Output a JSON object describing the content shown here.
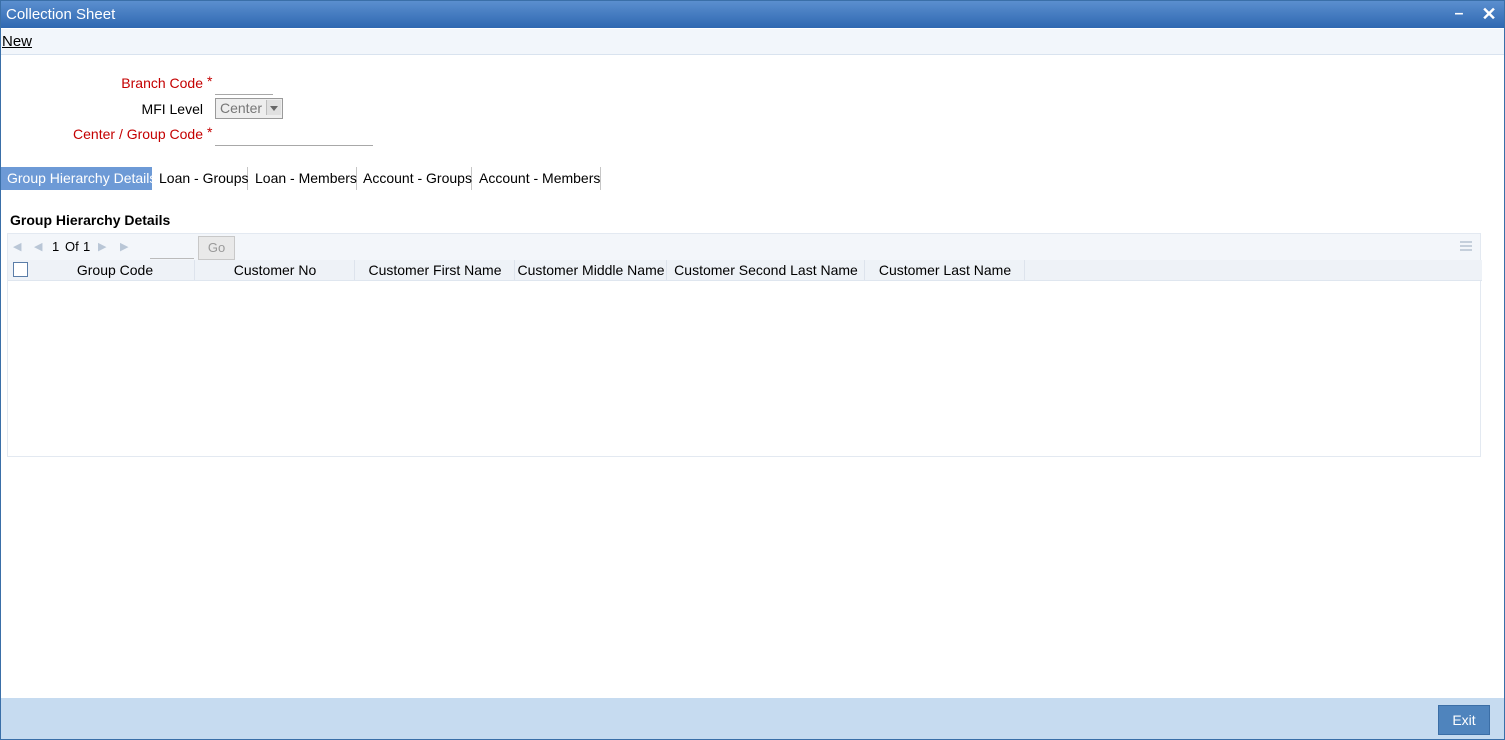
{
  "window": {
    "title": "Collection Sheet"
  },
  "menu": {
    "new_label": "New"
  },
  "form": {
    "branch_code_label": "Branch Code",
    "branch_code_value": "",
    "mfi_level_label": "MFI Level",
    "mfi_level_value": "Center",
    "center_group_label": "Center / Group Code",
    "center_group_value": "",
    "required_mark": "*"
  },
  "tabs": [
    {
      "label": "Group Hierarchy Details",
      "active": true
    },
    {
      "label": "Loan - Groups"
    },
    {
      "label": "Loan - Members"
    },
    {
      "label": "Account - Groups"
    },
    {
      "label": "Account - Members"
    }
  ],
  "section": {
    "title": "Group Hierarchy Details"
  },
  "pager": {
    "current": "1",
    "of_label": "Of",
    "total": "1",
    "go_label": "Go"
  },
  "table": {
    "columns": [
      "Group Code",
      "Customer No",
      "Customer First Name",
      "Customer Middle Name",
      "Customer Second Last Name",
      "Customer Last Name"
    ],
    "rows": []
  },
  "footer": {
    "exit_label": "Exit"
  },
  "colors": {
    "title_bar": "#2f68b1",
    "active_tab": "#6d9ad6",
    "footer": "#c6dbf0",
    "required": "#c40000"
  }
}
